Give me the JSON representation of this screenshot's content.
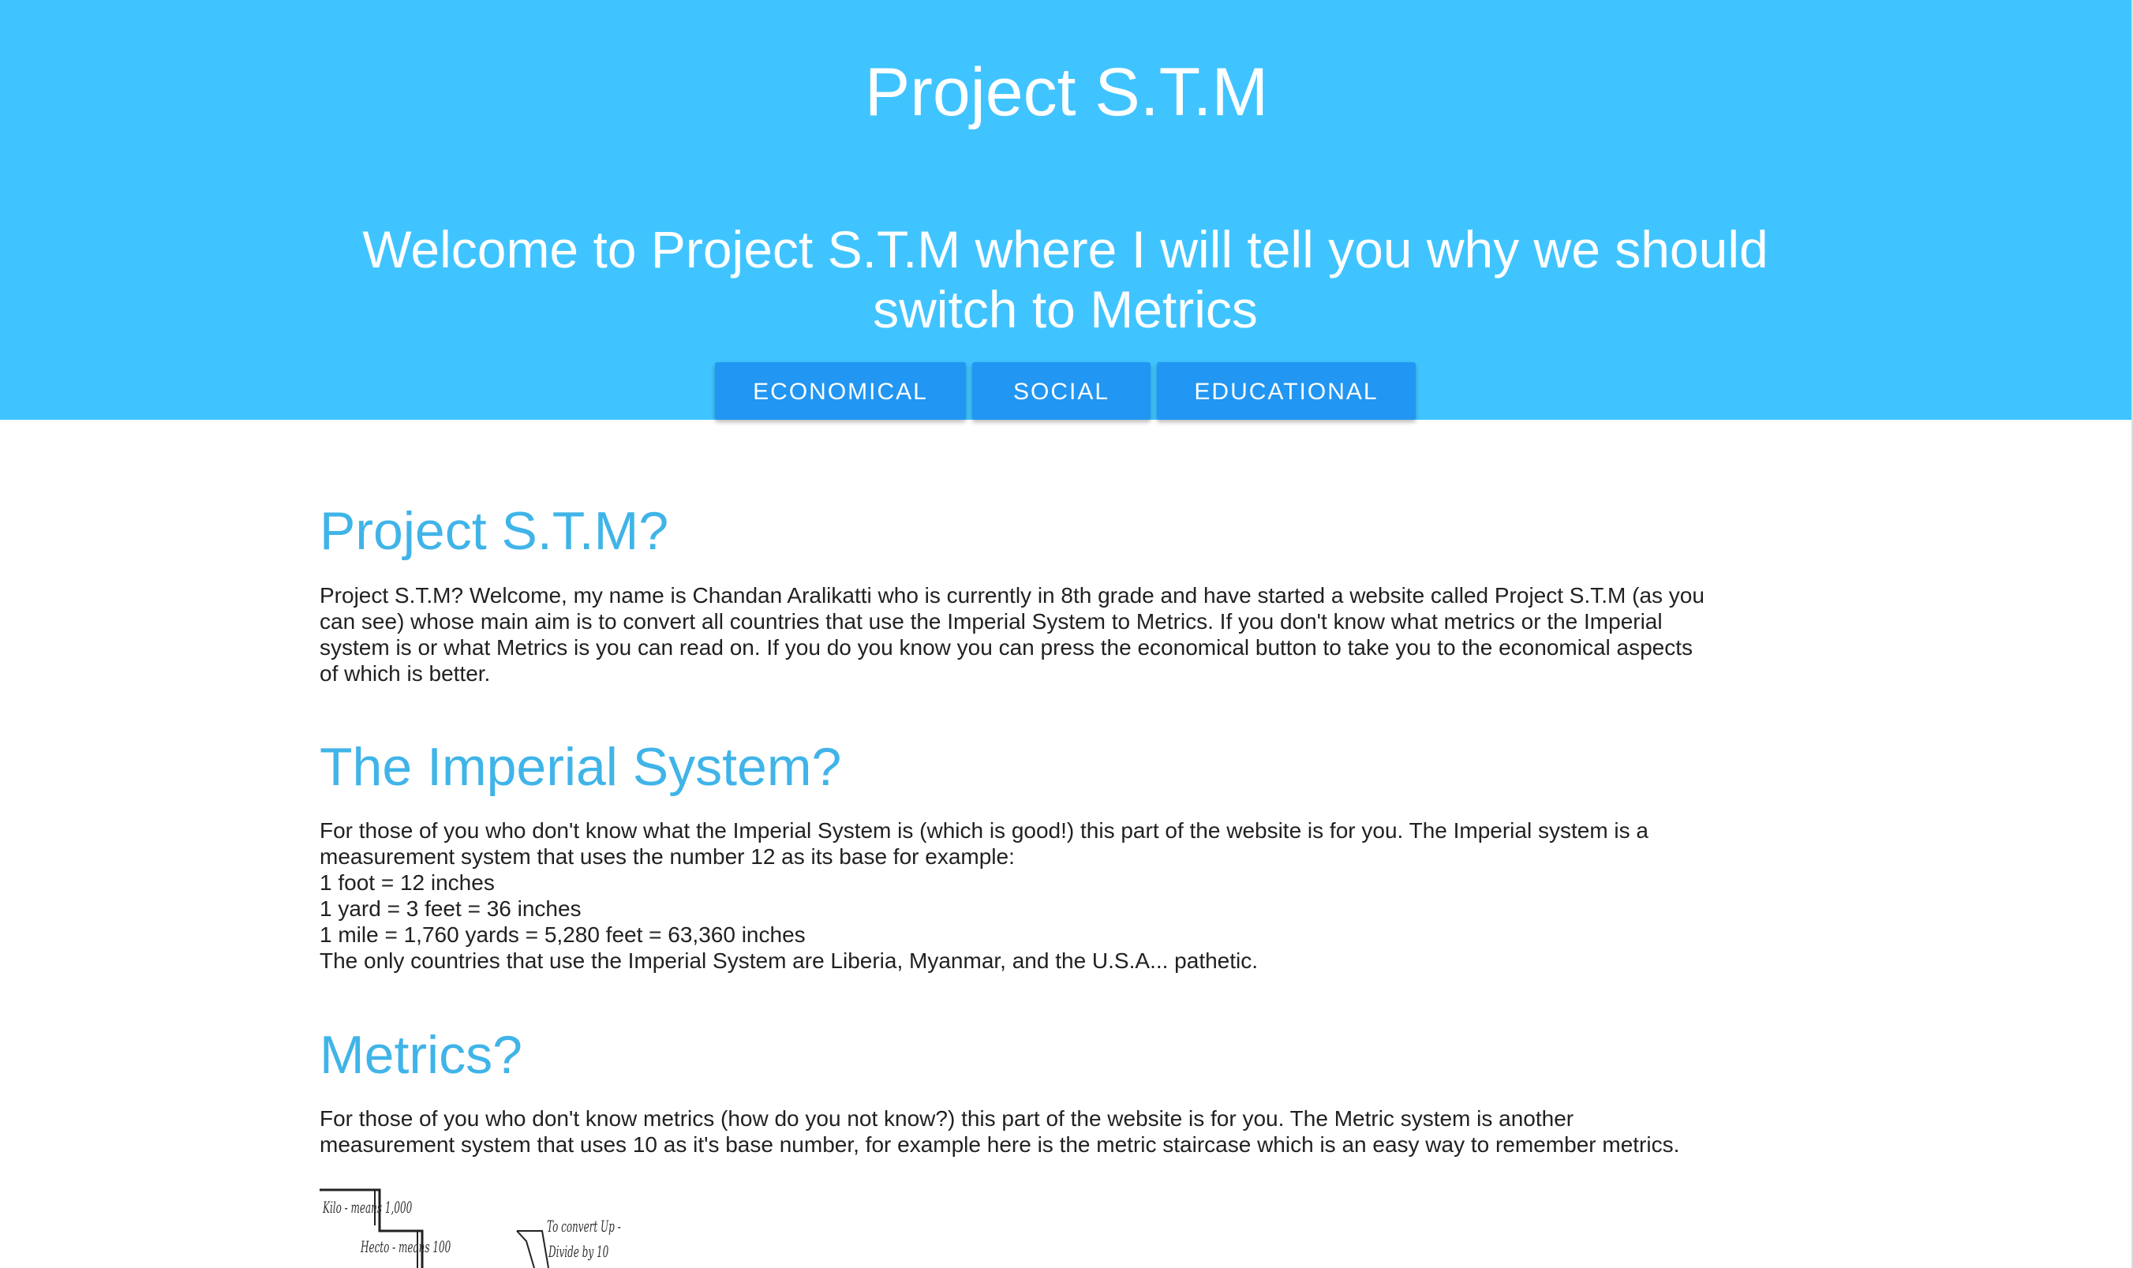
{
  "header": {
    "title": "Project S.T.M",
    "subtitle": "Welcome to Project S.T.M where I will tell you why we should switch to Metrics",
    "nav_buttons": [
      "ECONOMICAL",
      "SOCIAL",
      "EDUCATIONAL"
    ]
  },
  "sections": [
    {
      "heading": "Project S.T.M?",
      "lines": [
        "Project S.T.M? Welcome, my name is Chandan Aralikatti who is currently in 8th grade and have started a website called Project S.T.M (as you",
        "can see) whose main aim is to convert all countries that use the Imperial System to Metrics. If you don't know what metrics or the Imperial",
        "system is or what Metrics is you can read on. If you do you know you can press the economical button to take you to the economical aspects",
        "of which is better."
      ]
    },
    {
      "heading": "The Imperial System?",
      "lines": [
        "For those of you who don't know what the Imperial System is (which is good!) this part of the website is for you. The Imperial system is a",
        "measurement system that uses the number 12 as its base for example:",
        "1 foot = 12 inches",
        "1 yard = 3 feet = 36 inches",
        "1 mile = 1,760 yards = 5,280 feet = 63,360 inches",
        "The only countries that use the Imperial System are Liberia, Myanmar, and the U.S.A... pathetic."
      ]
    },
    {
      "heading": "Metrics?",
      "lines": [
        "For those of you who don't know metrics (how do you not know?) this part of the website is for you. The Metric system is another",
        "measurement system that uses 10 as it's base number, for example here is the metric staircase which is an easy way to remember metrics."
      ]
    }
  ],
  "staircase_image": {
    "labels": {
      "kilo": "Kilo - means 1,000",
      "hecto": "Hecto - means 100",
      "convert_up": "To convert Up -",
      "divide": "Divide by 10"
    }
  },
  "colors": {
    "header_bg": "#40c4ff",
    "button_bg": "#2196f3",
    "heading": "#40b4e8",
    "body_text": "#212121"
  }
}
